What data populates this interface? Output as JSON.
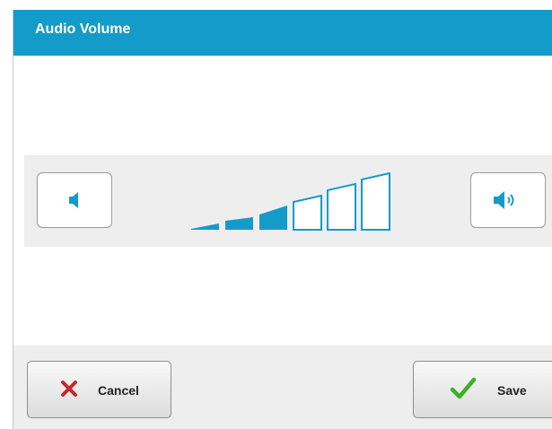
{
  "dialog": {
    "title": "Audio Volume"
  },
  "volume": {
    "level": 3,
    "max_level": 6,
    "down_icon": "speaker-icon",
    "up_icon": "speaker-loud-icon",
    "fill_color": "#139bc9"
  },
  "footer": {
    "cancel_label": "Cancel",
    "cancel_icon": "close-icon",
    "save_label": "Save",
    "save_icon": "checkmark-icon"
  },
  "colors": {
    "header": "#139bc9",
    "cancel_icon": "#c62828",
    "save_icon": "#3fae29"
  }
}
